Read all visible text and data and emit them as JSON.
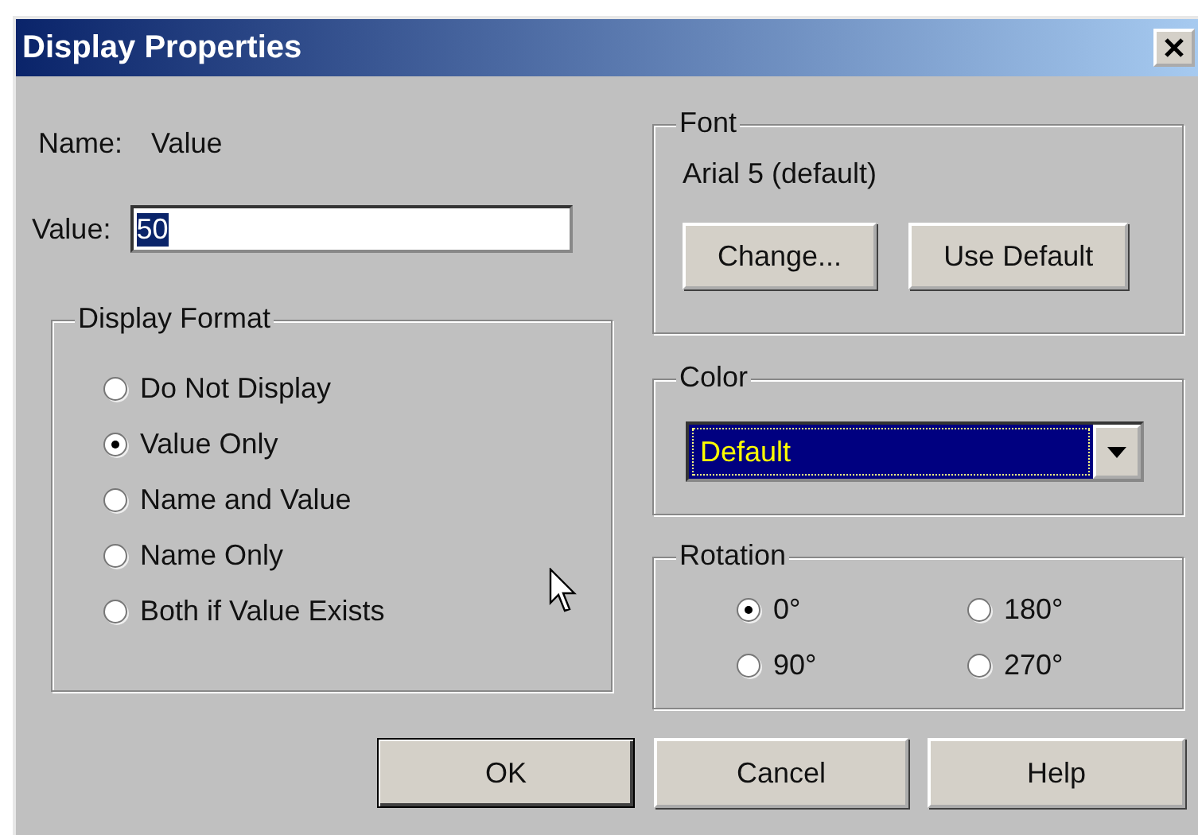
{
  "window": {
    "title": "Display Properties"
  },
  "name_row": {
    "label": "Name:",
    "value": "Value"
  },
  "value_field": {
    "label": "Value:",
    "value": "50",
    "text_selected": true
  },
  "display_format": {
    "title": "Display Format",
    "options": [
      {
        "label": "Do Not Display",
        "selected": false
      },
      {
        "label": "Value Only",
        "selected": true
      },
      {
        "label": "Name and Value",
        "selected": false
      },
      {
        "label": "Name Only",
        "selected": false
      },
      {
        "label": "Both if Value Exists",
        "selected": false
      }
    ]
  },
  "font": {
    "title": "Font",
    "current": "Arial 5 (default)",
    "buttons": [
      "Change...",
      "Use Default"
    ]
  },
  "color": {
    "title": "Color",
    "value": "Default"
  },
  "rotation": {
    "title": "Rotation",
    "options": [
      {
        "label": "0°",
        "selected": true
      },
      {
        "label": "180°",
        "selected": false
      },
      {
        "label": "90°",
        "selected": false
      },
      {
        "label": "270°",
        "selected": false
      }
    ]
  },
  "buttons": [
    {
      "label": "OK",
      "default": true
    },
    {
      "label": "Cancel",
      "default": false
    },
    {
      "label": "Help",
      "default": false
    }
  ]
}
